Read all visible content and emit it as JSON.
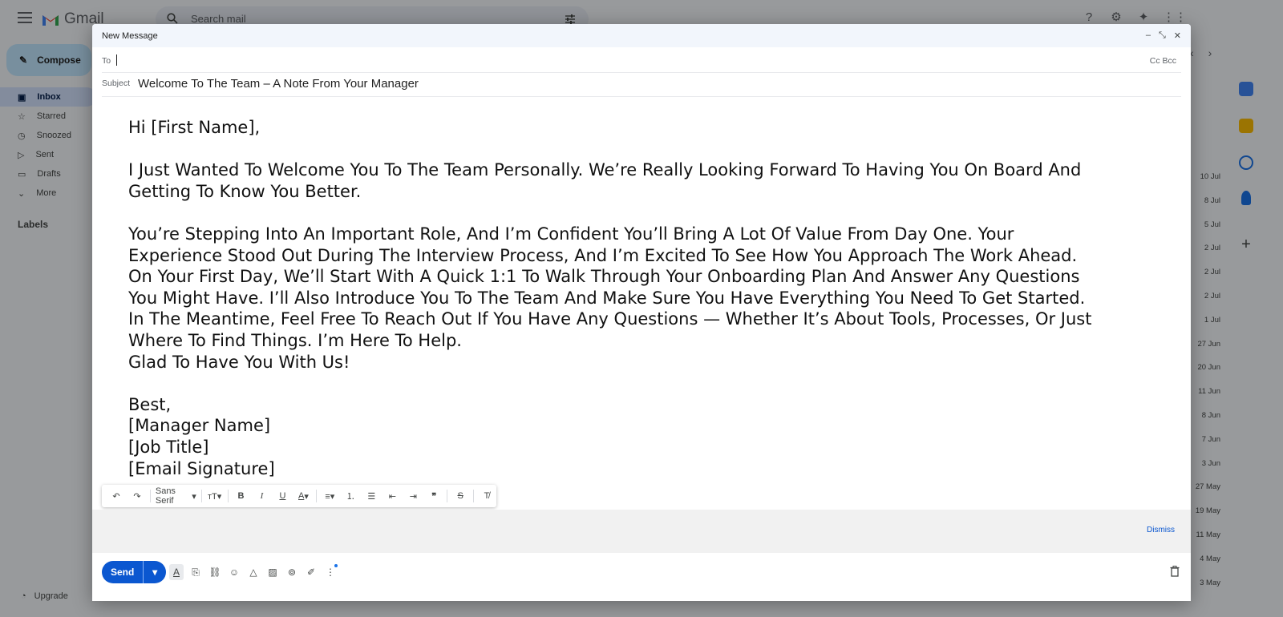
{
  "app": {
    "name": "Gmail"
  },
  "search": {
    "placeholder": "Search mail"
  },
  "compose_button": {
    "label": "Compose"
  },
  "sidebar": {
    "items": [
      {
        "label": "Inbox",
        "icon": "inbox-icon"
      },
      {
        "label": "Starred",
        "icon": "star-icon"
      },
      {
        "label": "Snoozed",
        "icon": "clock-icon"
      },
      {
        "label": "Sent",
        "icon": "send-icon"
      },
      {
        "label": "Drafts",
        "icon": "draft-icon"
      },
      {
        "label": "More",
        "icon": "chevron-down-icon"
      }
    ],
    "labels_heading": "Labels",
    "upgrade": "Upgrade"
  },
  "inbox_dates": [
    "10 Jul",
    "8 Jul",
    "5 Jul",
    "2 Jul",
    "2 Jul",
    "2 Jul",
    "1 Jul",
    "27 Jun",
    "20 Jun",
    "11 Jun",
    "8 Jun",
    "7 Jun",
    "3 Jun",
    "27 May",
    "19 May",
    "11 May",
    "4 May",
    "3 May"
  ],
  "compose": {
    "title": "New Message",
    "to_label": "To",
    "to_value": "",
    "cc_bcc": "Cc Bcc",
    "subject_label": "Subject",
    "subject_value": "Welcome To The Team – A Note From Your Manager",
    "body": {
      "greeting": "Hi [First Name],",
      "para1": [
        "I Just Wanted To Welcome You To The Team Personally. We’re Really Looking Forward To Having You On Board And",
        "Getting To Know You Better."
      ],
      "para2": [
        "You’re Stepping Into An Important Role, And I’m Confident You’ll Bring A Lot Of Value From Day One. Your",
        "Experience Stood Out During The Interview Process, And I’m Excited To See How You Approach The Work Ahead.",
        "On Your First Day, We’ll Start With A Quick 1:1 To Walk Through Your Onboarding Plan And Answer Any Questions",
        "You Might Have. I’ll Also Introduce You To The Team And Make Sure You Have Everything You Need To Get Started.",
        "In The Meantime, Feel Free To Reach Out If You Have Any Questions — Whether It’s About Tools, Processes, Or Just",
        "Where To Find Things. I’m Here To Help.",
        "Glad To Have You With Us!"
      ],
      "signoff": [
        "Best,",
        "[Manager Name]",
        "[Job Title]",
        "[Email Signature]"
      ]
    },
    "format_bar": {
      "font": "Sans Serif"
    },
    "notice": {
      "dismiss": "Dismiss"
    },
    "send_label": "Send"
  }
}
